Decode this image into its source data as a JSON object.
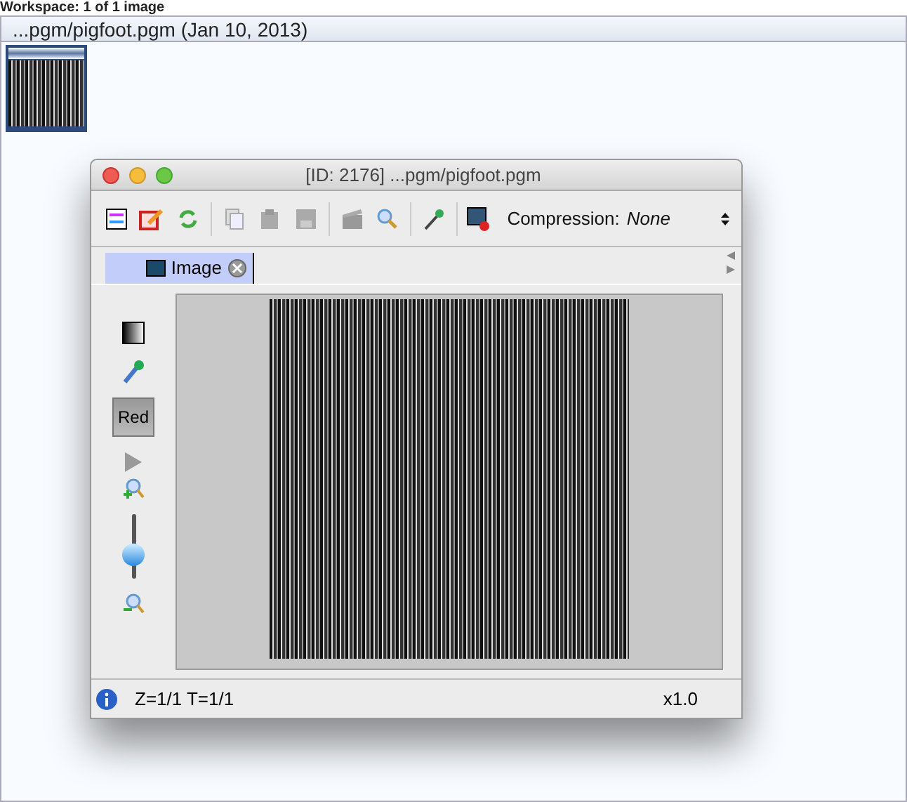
{
  "workspace": {
    "title": "Workspace: 1 of 1 image",
    "header": "...pgm/pigfoot.pgm (Jan 10, 2013)",
    "thumbnails": [
      {
        "selected": true
      }
    ]
  },
  "viewer": {
    "title": "[ID: 2176] ...pgm/pigfoot.pgm",
    "compression_label": "Compression:",
    "compression_value": "None",
    "tabs": [
      {
        "label": "Image",
        "selected": true
      }
    ],
    "channel_button": "Red",
    "zoom_slider": {
      "level": 0.3
    },
    "status": "Z=1/1 T=1/1",
    "zoom": "x1.0"
  }
}
